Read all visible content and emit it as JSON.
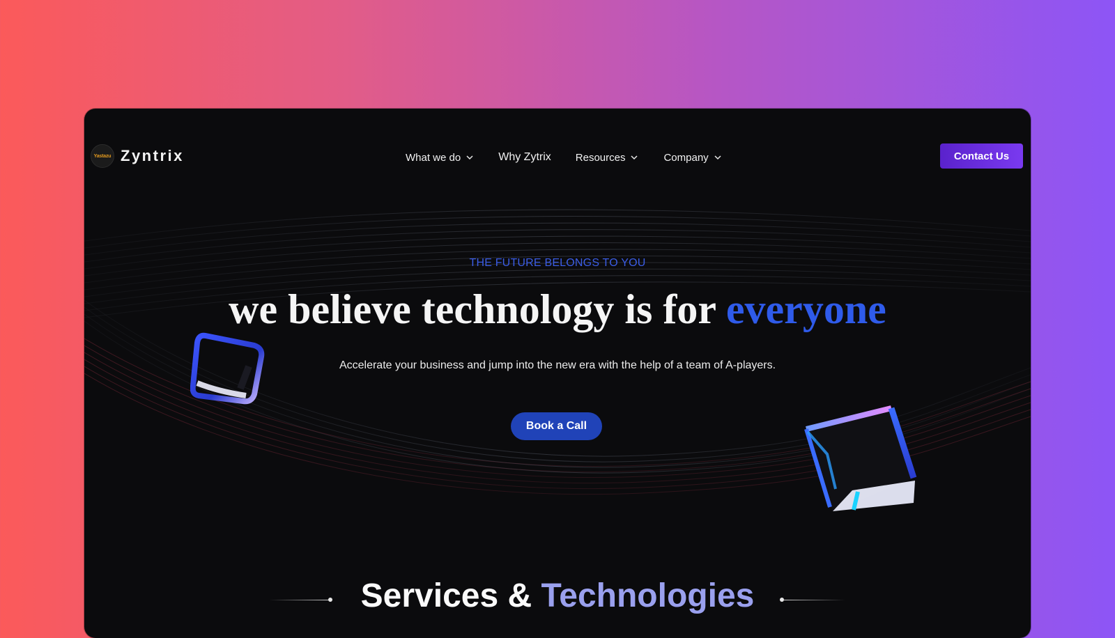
{
  "brand": {
    "name": "Zyntrix",
    "logo_badge_text": "Yastazu"
  },
  "nav": {
    "items": [
      {
        "label": "What we do",
        "has_dropdown": true
      },
      {
        "label": "Why Zytrix",
        "has_dropdown": false
      },
      {
        "label": "Resources",
        "has_dropdown": true
      },
      {
        "label": "Company",
        "has_dropdown": true
      }
    ],
    "contact_label": "Contact Us"
  },
  "hero": {
    "eyebrow": "THE FUTURE BELONGS TO YOU",
    "headline_prefix": "we believe technology is for",
    "headline_accent": "everyone",
    "subtitle": "Accelerate your business and jump into the new era with the help of a team of A-players.",
    "cta_label": "Book a Call"
  },
  "services": {
    "title_part1": "Services &",
    "title_part2": "Technologies"
  },
  "colors": {
    "background_gradient": [
      "#fb5a5a",
      "#e35c86",
      "#b556c6",
      "#8d55f6"
    ],
    "window_bg": "#0b0b0d",
    "accent_blue": "#2f5bea",
    "eyebrow_blue": "#3b5de6",
    "cta_bg": "#2043b8",
    "contact_gradient": [
      "#5a22cc",
      "#7a3af0"
    ],
    "services_accent": "#9aa0ee"
  },
  "icons": {
    "nav_dropdown": "chevron-down-icon",
    "hero_decor": "glass-cube-icon"
  }
}
